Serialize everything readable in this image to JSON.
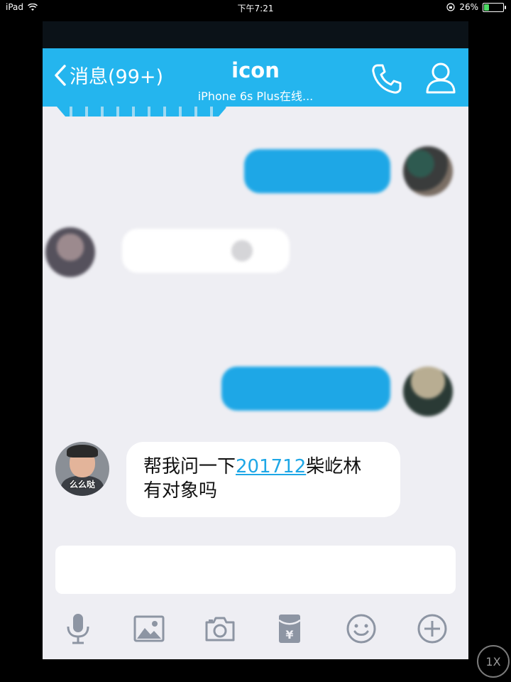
{
  "status_bar": {
    "device": "iPad",
    "time": "下午7:21",
    "battery": "26%",
    "battery_level": 0.26
  },
  "nav": {
    "back_label": "消息(99+)",
    "title": "icon",
    "subtitle": "iPhone 6s Plus在线..."
  },
  "message": {
    "avatar_caption": "么么哒",
    "text_before_link": "帮我问一下",
    "link_text": "201712",
    "text_after_link": "柴屹林",
    "text_line2": "有对象吗"
  },
  "input": {
    "placeholder": ""
  },
  "toolbar": {
    "icons": [
      "microphone-icon",
      "image-icon",
      "camera-icon",
      "red-packet-icon",
      "emoji-icon",
      "plus-icon"
    ],
    "red_packet_symbol": "¥"
  },
  "speed_badge": "1X",
  "colors": {
    "nav_blue": "#24b5ee",
    "bubble_blue": "#1ea7e6",
    "chat_bg": "#eeeef3"
  }
}
